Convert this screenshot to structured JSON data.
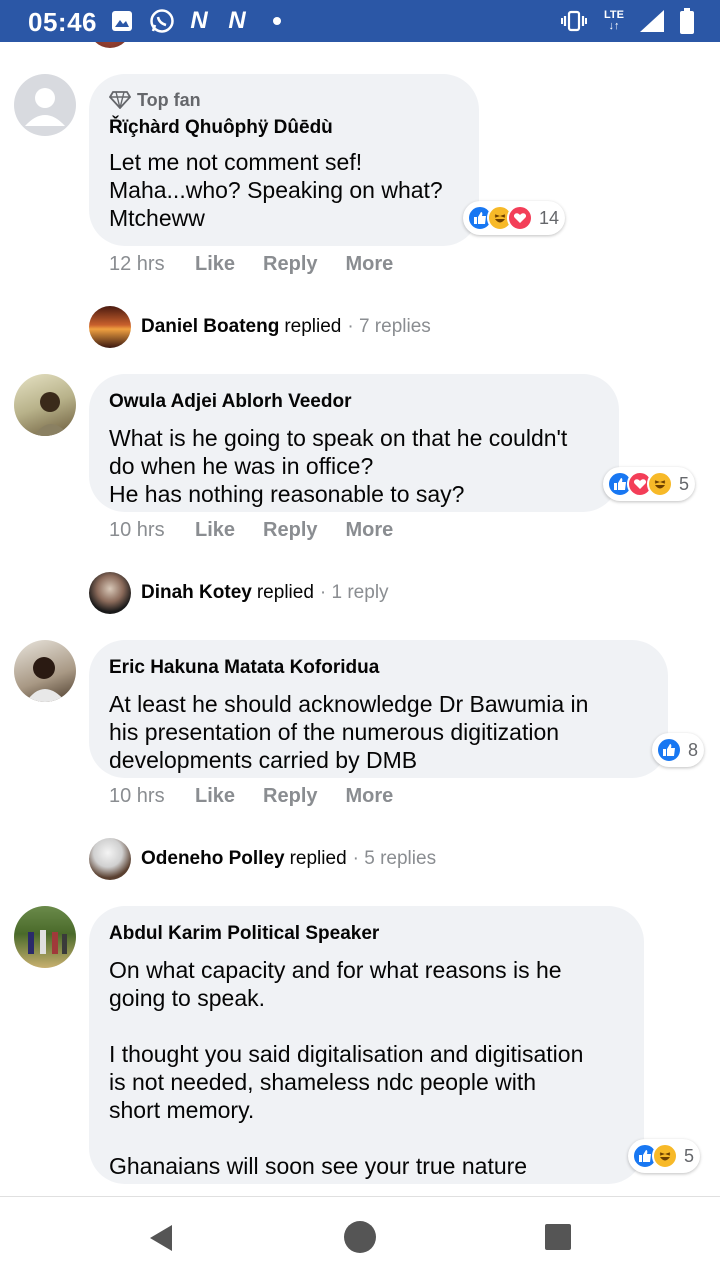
{
  "status_bar": {
    "time": "05:46",
    "icons": [
      "image-icon",
      "whatsapp-icon",
      "n-icon",
      "n-icon",
      "dot-icon",
      "vibrate-icon",
      "lte-icon",
      "signal-icon",
      "battery-icon"
    ],
    "n_label": "N",
    "lte_label": "LTE"
  },
  "comments": [
    {
      "badge": "Top fan",
      "author": "Řïçhàrd Qhuôphÿ Dûēdù",
      "text": "Let me not comment sef!\nMaha...who? Speaking on what?\nMtcheww",
      "reactions": [
        "like",
        "haha",
        "love"
      ],
      "reaction_count": "14",
      "time": "12 hrs",
      "actions": [
        "Like",
        "Reply",
        "More"
      ],
      "reply_preview": {
        "name": "Daniel Boateng",
        "word": "replied",
        "count": "· 7 replies"
      }
    },
    {
      "author": "Owula Adjei Ablorh Veedor",
      "text": "What is he going to speak on that he couldn't\ndo when he was in office?\nHe has nothing reasonable to say?",
      "reactions": [
        "like",
        "love",
        "haha"
      ],
      "reaction_count": "5",
      "time": "10 hrs",
      "actions": [
        "Like",
        "Reply",
        "More"
      ],
      "reply_preview": {
        "name": "Dinah Kotey",
        "word": "replied",
        "count": "· 1 reply"
      }
    },
    {
      "author": "Eric Hakuna Matata Koforidua",
      "text": "At least he should acknowledge Dr Bawumia in\nhis presentation of the numerous digitization\ndevelopments carried by DMB",
      "reactions": [
        "like"
      ],
      "reaction_count": "8",
      "time": "10 hrs",
      "actions": [
        "Like",
        "Reply",
        "More"
      ],
      "reply_preview": {
        "name": "Odeneho Polley",
        "word": "replied",
        "count": "· 5 replies"
      }
    },
    {
      "author": "Abdul Karim Political Speaker",
      "text": "On what capacity and for what reasons is he\ngoing to speak.\n\nI thought you said digitalisation and digitisation\nis not needed, shameless ndc people with\nshort memory.\n\nGhanaians will soon see your true nature",
      "reactions": [
        "like",
        "haha"
      ],
      "reaction_count": "5"
    }
  ],
  "nav_bar": {
    "buttons": [
      "back-icon",
      "home-icon",
      "recents-icon"
    ]
  },
  "colors": {
    "status_bar": "#2b57a6",
    "bubble": "#f0f2f5",
    "like": "#1877f2",
    "love": "#f33e58",
    "haha": "#f7b928"
  }
}
